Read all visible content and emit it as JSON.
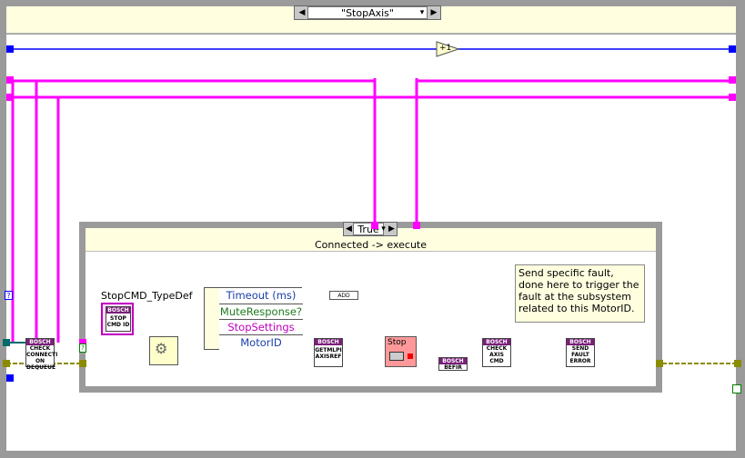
{
  "outer_case": {
    "selector_label": "\"StopAxis\""
  },
  "iteration_node": "+1",
  "inner_case": {
    "selector_label": "True",
    "subtitle": "Connected -> execute"
  },
  "comment_text": "Send specific fault, done here to trigger the fault at the subsystem related to this MotorID.",
  "typedef_label": "StopCMD_TypeDef",
  "cluster": {
    "rows": [
      "Timeout (ms)",
      "MuteResponse?",
      "StopSettings",
      "MotorID"
    ]
  },
  "add_node": "ADD",
  "stop_node": "Stop",
  "vis": {
    "check_connection": {
      "brand": "BOSCH",
      "text": "CHECK CONNECTI ON DEQUEUE"
    },
    "stop_cmd_id": {
      "brand": "BOSCH",
      "text": "STOP CMD ID"
    },
    "getmlpi": {
      "brand": "BOSCH",
      "text": "GETMLPI AXISREF"
    },
    "befir": {
      "brand": "BOSCH",
      "text": "BEFIR"
    },
    "check_axis": {
      "brand": "BOSCH",
      "text": "CHECK AXIS CMD"
    },
    "send_fault": {
      "brand": "BOSCH",
      "text": "SEND FAULT ERROR"
    }
  },
  "colors": {
    "pink_wire": "#ff00ff",
    "blue_wire": "#0000ff",
    "olive_wire": "#8b8b00",
    "teal_wire": "#006a6a",
    "navy_wire": "#00008b",
    "frame_gray": "#9a9a9a",
    "header_yellow": "#ffffe0",
    "vi_purple": "#7a1f7a"
  }
}
